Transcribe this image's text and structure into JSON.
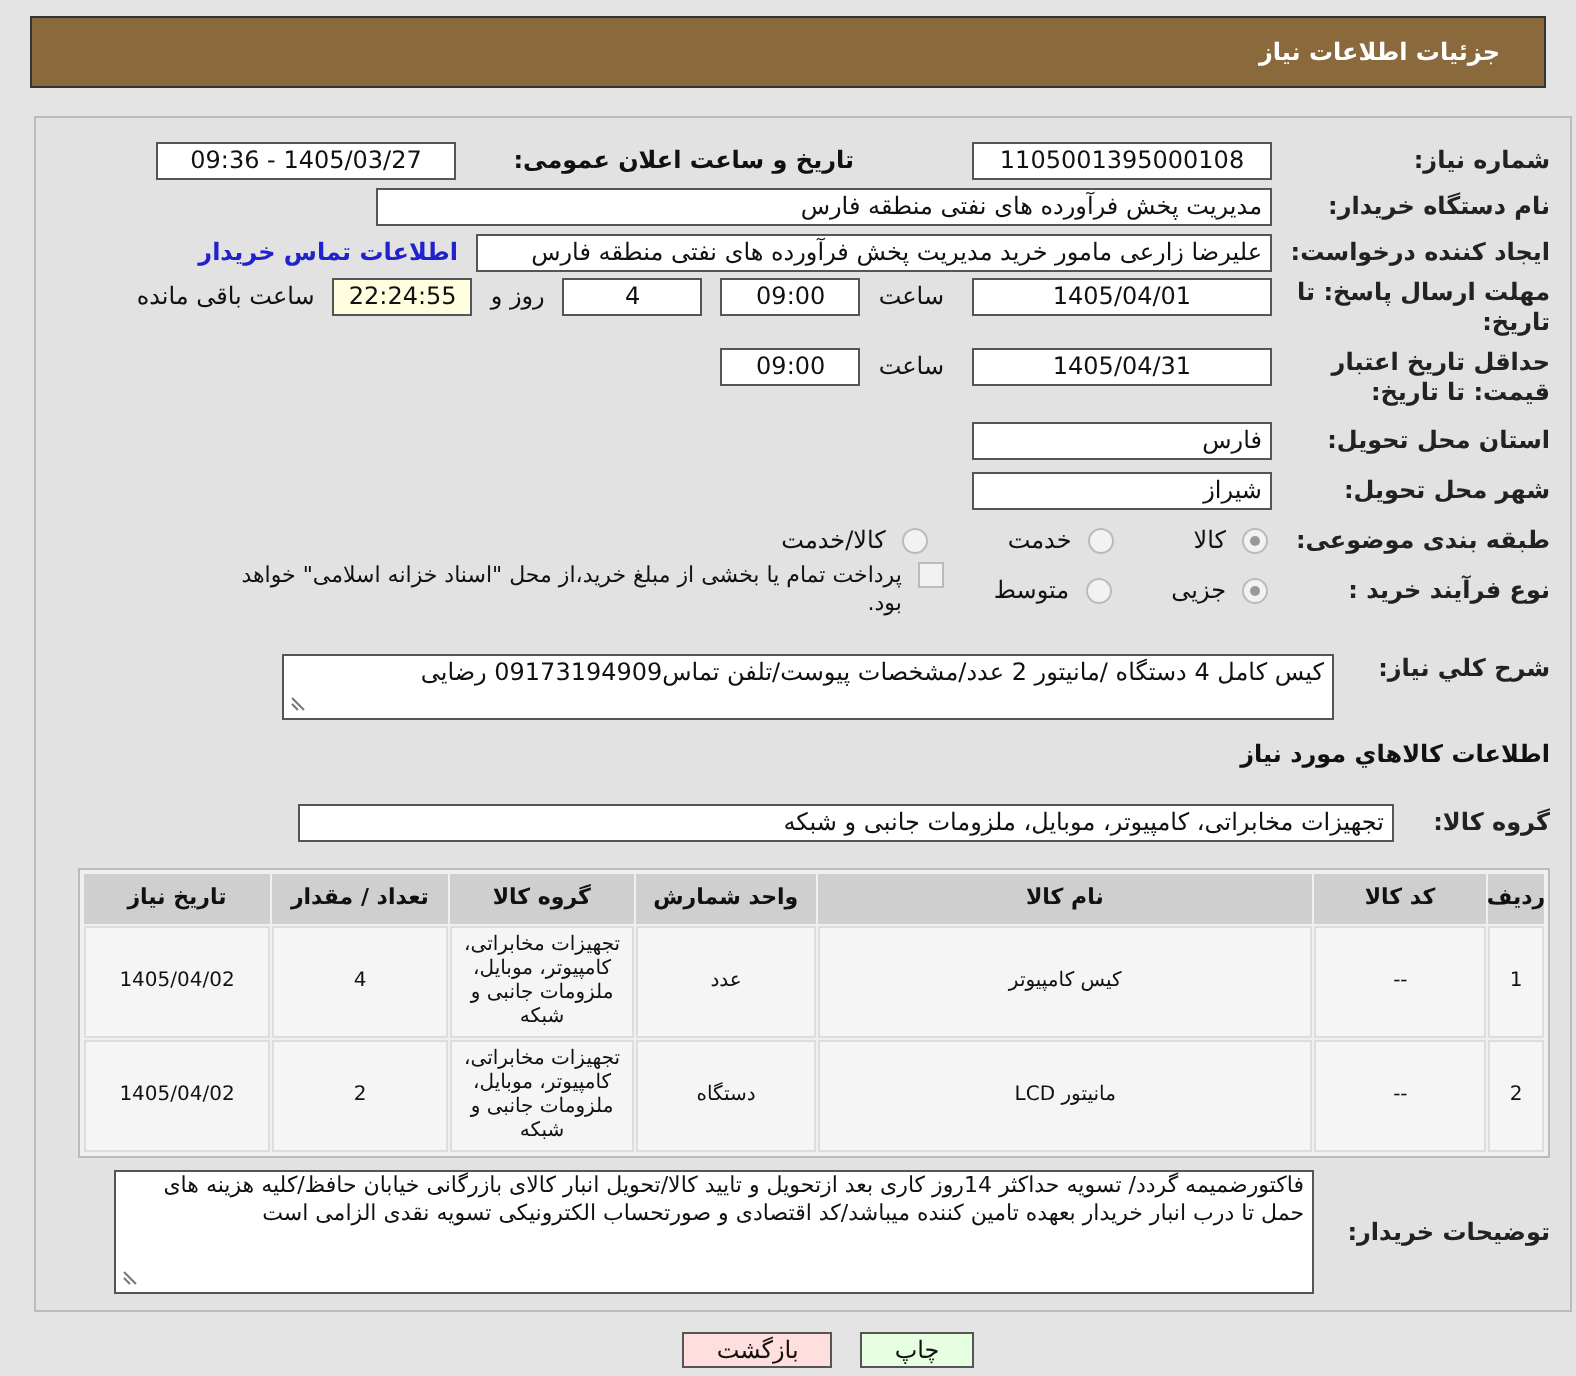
{
  "page_title": "جزئیات اطلاعات نیاز",
  "need_number": {
    "label": "شماره نیاز:",
    "value": "1105001395000108"
  },
  "announce": {
    "label": "تاریخ و ساعت اعلان عمومی:",
    "value": "1405/03/27 - 09:36"
  },
  "buyer_org": {
    "label": "نام دستگاه خریدار:",
    "value": "مدیریت پخش فرآورده های نفتی منطقه فارس"
  },
  "requester": {
    "label": "ایجاد کننده درخواست:",
    "value": "علیرضا زارعی مامور خرید مدیریت پخش فرآورده های نفتی منطقه فارس",
    "link": "اطلاعات تماس خریدار"
  },
  "reply_deadline": {
    "label": "مهلت ارسال پاسخ: تا تاریخ:",
    "date": "1405/04/01",
    "time_label": "ساعت",
    "time": "09:00",
    "days": "4",
    "days_label": "روز و",
    "remaining": "22:24:55",
    "remaining_label": "ساعت باقی مانده"
  },
  "price_validity": {
    "label": "حداقل تاریخ اعتبار قیمت: تا تاریخ:",
    "date": "1405/04/31",
    "time_label": "ساعت",
    "time": "09:00"
  },
  "province": {
    "label": "استان محل تحویل:",
    "value": "فارس"
  },
  "city": {
    "label": "شهر محل تحویل:",
    "value": "شیراز"
  },
  "category": {
    "label": "طبقه بندی موضوعی:",
    "options": [
      {
        "label": "کالا",
        "selected": true
      },
      {
        "label": "خدمت",
        "selected": false
      },
      {
        "label": "کالا/خدمت",
        "selected": false
      }
    ]
  },
  "process": {
    "label": "نوع فرآیند خرید :",
    "options": [
      {
        "label": "جزیی",
        "selected": true
      },
      {
        "label": "متوسط",
        "selected": false
      }
    ],
    "checkbox": {
      "label": "پرداخت تمام یا بخشی از مبلغ خرید،از محل \"اسناد خزانه اسلامی\" خواهد بود.",
      "checked": false
    }
  },
  "description": {
    "label": "شرح كلي نياز:",
    "value": "کیس کامل 4 دستگاه /مانیتور 2 عدد/مشخصات پیوست/تلفن تماس09173194909 رضایی"
  },
  "goods_heading": "اطلاعات کالاهاي مورد نياز",
  "goods_group": {
    "label": "گروه کالا:",
    "value": "تجهیزات مخابراتی، کامپیوتر، موبایل، ملزومات جانبی و شبکه"
  },
  "table": {
    "columns": [
      "ردیف",
      "کد کالا",
      "نام کالا",
      "واحد شمارش",
      "گروه کالا",
      "تعداد / مقدار",
      "تاریخ نیاز"
    ],
    "rows": [
      [
        "1",
        "--",
        "کیس کامپیوتر",
        "عدد",
        "تجهیزات مخابراتی، کامپیوتر، موبایل، ملزومات جانبی و شبکه",
        "4",
        "1405/04/02"
      ],
      [
        "2",
        "--",
        "مانیتور LCD",
        "دستگاه",
        "تجهیزات مخابراتی، کامپیوتر، موبایل، ملزومات جانبی و شبکه",
        "2",
        "1405/04/02"
      ]
    ]
  },
  "buyer_notes": {
    "label": "توضیحات خریدار:",
    "value": "فاکتورضمیمه گردد/ تسویه حداکثر 14روز کاری بعد ازتحویل و تایید کالا/تحویل انبار کالای بازرگانی خیابان حافظ/کلیه هزینه های حمل تا درب انبار خریدار بعهده تامین کننده میباشد/کد اقتصادی و صورتحساب الکترونیکی تسویه نقدی الزامی است"
  },
  "buttons": [
    {
      "label": "چاپ",
      "kind": "print"
    },
    {
      "label": "بازگشت",
      "kind": "back"
    }
  ]
}
